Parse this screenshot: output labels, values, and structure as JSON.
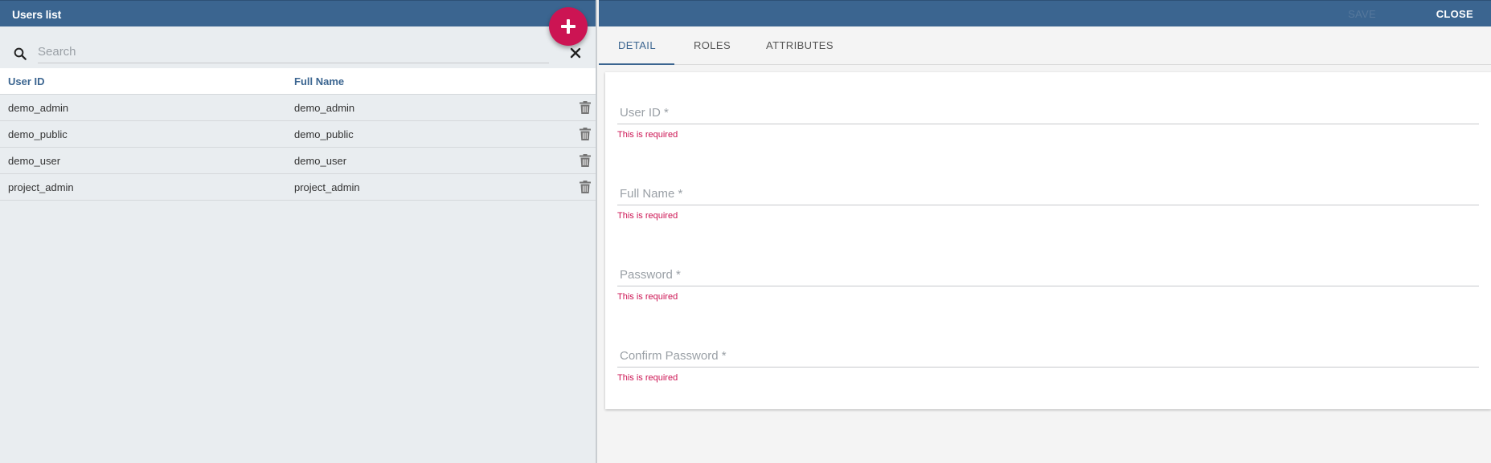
{
  "users_list": {
    "title": "Users list",
    "search_placeholder": "Search",
    "columns": {
      "user_id": "User ID",
      "full_name": "Full Name"
    },
    "rows": [
      {
        "user_id": "demo_admin",
        "full_name": "demo_admin"
      },
      {
        "user_id": "demo_public",
        "full_name": "demo_public"
      },
      {
        "user_id": "demo_user",
        "full_name": "demo_user"
      },
      {
        "user_id": "project_admin",
        "full_name": "project_admin"
      }
    ]
  },
  "detail": {
    "save_label": "SAVE",
    "close_label": "CLOSE",
    "tabs": [
      {
        "label": "DETAIL",
        "active": true
      },
      {
        "label": "ROLES",
        "active": false
      },
      {
        "label": "ATTRIBUTES",
        "active": false
      }
    ],
    "fields": [
      {
        "label": "User ID *",
        "error": "This is required"
      },
      {
        "label": "Full Name *",
        "error": "This is required"
      },
      {
        "label": "Password *",
        "error": "This is required"
      },
      {
        "label": "Confirm Password *",
        "error": "This is required"
      }
    ]
  },
  "colors": {
    "header": "#3b6590",
    "accent": "#cc1453",
    "panel_bg": "#e9edf0"
  },
  "icons": [
    "plus-icon",
    "search-icon",
    "close-icon",
    "trash-icon"
  ]
}
